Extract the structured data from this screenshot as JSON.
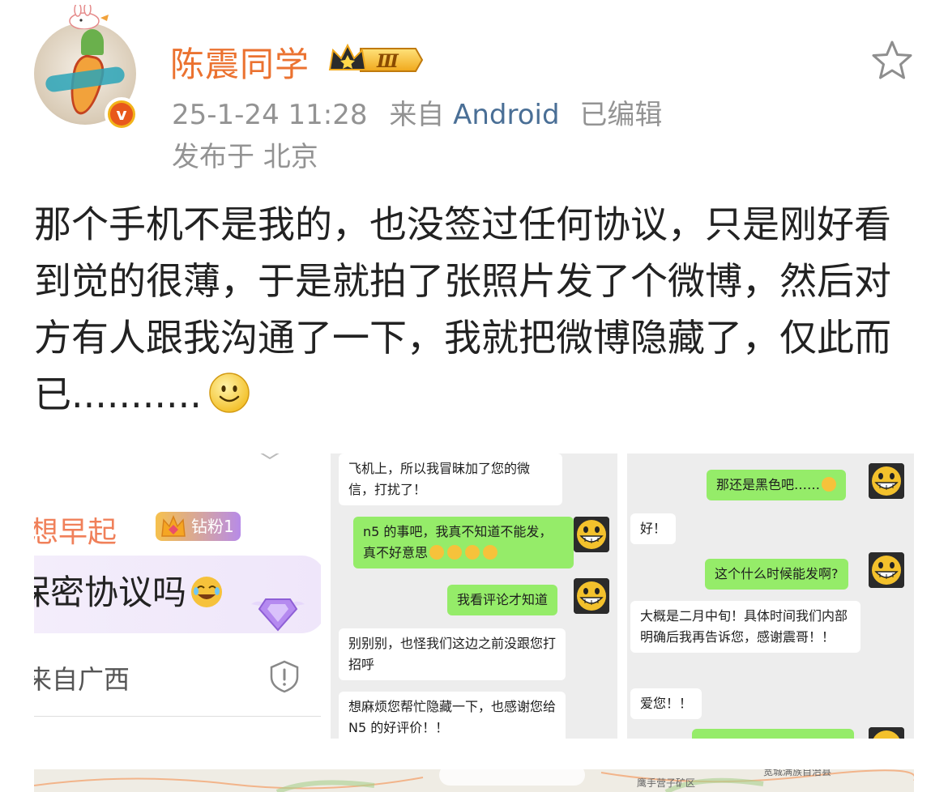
{
  "post": {
    "username": "陈震同学",
    "member_level": "Ⅲ",
    "timestamp": "25-1-24 11:28",
    "from_label": "来自",
    "source": "Android",
    "edited": "已编辑",
    "location": "发布于 北京",
    "text": "那个手机不是我的，也没签过任何协议，只是刚好看到觉的很薄，于是就拍了张照片发了个微博，然后对方有人跟我沟通了一下，我就把微博隐藏了，仅此而已...........",
    "emoji": "smiley-emoji"
  },
  "images": {
    "img1": {
      "commenter": "想早起",
      "fan_badge": "钻粉1",
      "comment": "保密协议吗",
      "from_location": "来自广西"
    },
    "img2": {
      "messages": [
        {
          "side": "left",
          "text": "飞机上，所以我冒昧加了您的微信，打扰了！"
        },
        {
          "side": "right",
          "text": "n5 的事吧，我真不知道不能发，真不好意思"
        },
        {
          "side": "right",
          "text": "我看评论才知道"
        },
        {
          "side": "left",
          "text": "别别别，也怪我们这边之前没跟您打招呼"
        },
        {
          "side": "left",
          "text": "想麻烦您帮忙隐藏一下，也感谢您给 N5 的好评价！！"
        }
      ]
    },
    "img3": {
      "messages": [
        {
          "side": "right",
          "text": "那还是黑色吧……"
        },
        {
          "side": "left",
          "text": "好！"
        },
        {
          "side": "right",
          "text": "这个什么时候能发啊?"
        },
        {
          "side": "left",
          "text": "大概是二月中旬！具体时间我们内部明确后我再告诉您，感谢震哥！！"
        },
        {
          "side": "left",
          "text": "爱您！！"
        }
      ]
    }
  },
  "map": {
    "labels": [
      "鹰手营子矿区",
      "宽城满族自治县"
    ]
  },
  "colors": {
    "username": "#eb7230",
    "meta_gray": "#939393",
    "source_link": "#4a6f96",
    "wechat_green": "#95ec69"
  }
}
